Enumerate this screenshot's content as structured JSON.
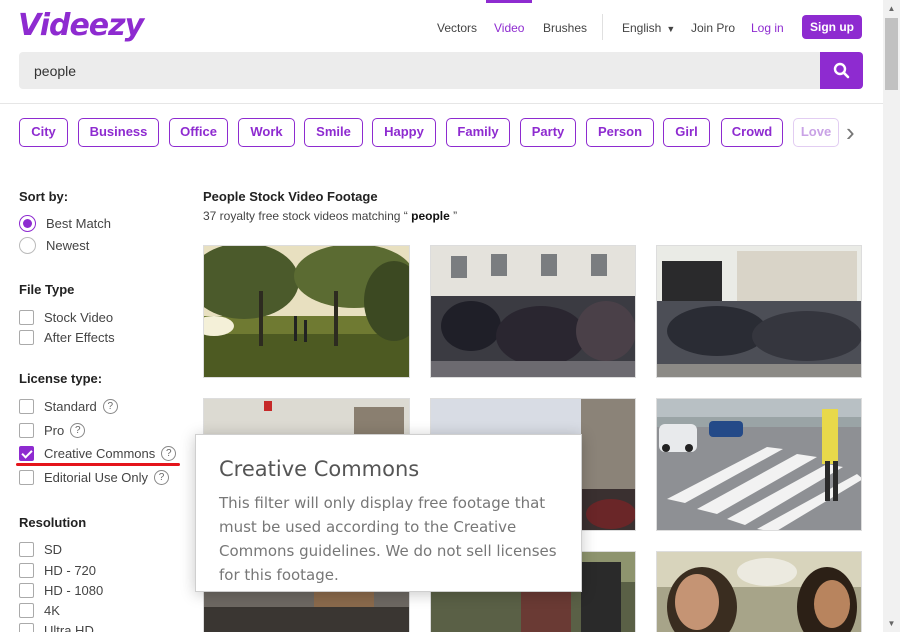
{
  "brand": {
    "logo": "Videezy",
    "accent": "#8e2bd0"
  },
  "nav": {
    "vectors": "Vectors",
    "video": "Video",
    "brushes": "Brushes",
    "language": "English",
    "join_pro": "Join Pro",
    "login": "Log in",
    "signup": "Sign up"
  },
  "search": {
    "value": "people",
    "placeholder": "",
    "icon": "search-icon"
  },
  "tags": [
    "City",
    "Business",
    "Office",
    "Work",
    "Smile",
    "Happy",
    "Family",
    "Party",
    "Person",
    "Girl",
    "Crowd",
    "Love"
  ],
  "sidebar": {
    "sort_by": {
      "heading": "Sort by:",
      "options": [
        {
          "label": "Best Match",
          "selected": true
        },
        {
          "label": "Newest",
          "selected": false
        }
      ]
    },
    "file_type": {
      "heading": "File Type",
      "options": [
        {
          "label": "Stock Video",
          "checked": false
        },
        {
          "label": "After Effects",
          "checked": false
        }
      ]
    },
    "license_type": {
      "heading": "License type:",
      "options": [
        {
          "label": "Standard",
          "checked": false,
          "help": "?"
        },
        {
          "label": "Pro",
          "checked": false,
          "help": "?"
        },
        {
          "label": "Creative Commons",
          "checked": true,
          "help": "?"
        },
        {
          "label": "Editorial Use Only",
          "checked": false,
          "help": "?"
        }
      ]
    },
    "resolution": {
      "heading": "Resolution",
      "options": [
        {
          "label": "SD",
          "checked": false
        },
        {
          "label": "HD - 720",
          "checked": false
        },
        {
          "label": "HD - 1080",
          "checked": false
        },
        {
          "label": "4K",
          "checked": false
        },
        {
          "label": "Ultra HD",
          "checked": false
        }
      ]
    }
  },
  "results": {
    "title": "People Stock Video Footage",
    "count_prefix": "37 royalty free stock videos matching",
    "query_open": "“",
    "query": "people",
    "query_close": "”"
  },
  "tooltip": {
    "title": "Creative Commons",
    "body": "This filter will only display free footage that must be used according to the Creative Commons guidelines. We do not sell licenses for this footage."
  },
  "thumbnails": [
    {
      "scene": "park-sunset"
    },
    {
      "scene": "crowd-street"
    },
    {
      "scene": "crowd-building"
    },
    {
      "scene": "street-flags"
    },
    {
      "scene": "street-crowd-2"
    },
    {
      "scene": "crosswalk"
    },
    {
      "scene": "street-buildings"
    },
    {
      "scene": "people-walking"
    },
    {
      "scene": "couple-fountain"
    }
  ]
}
